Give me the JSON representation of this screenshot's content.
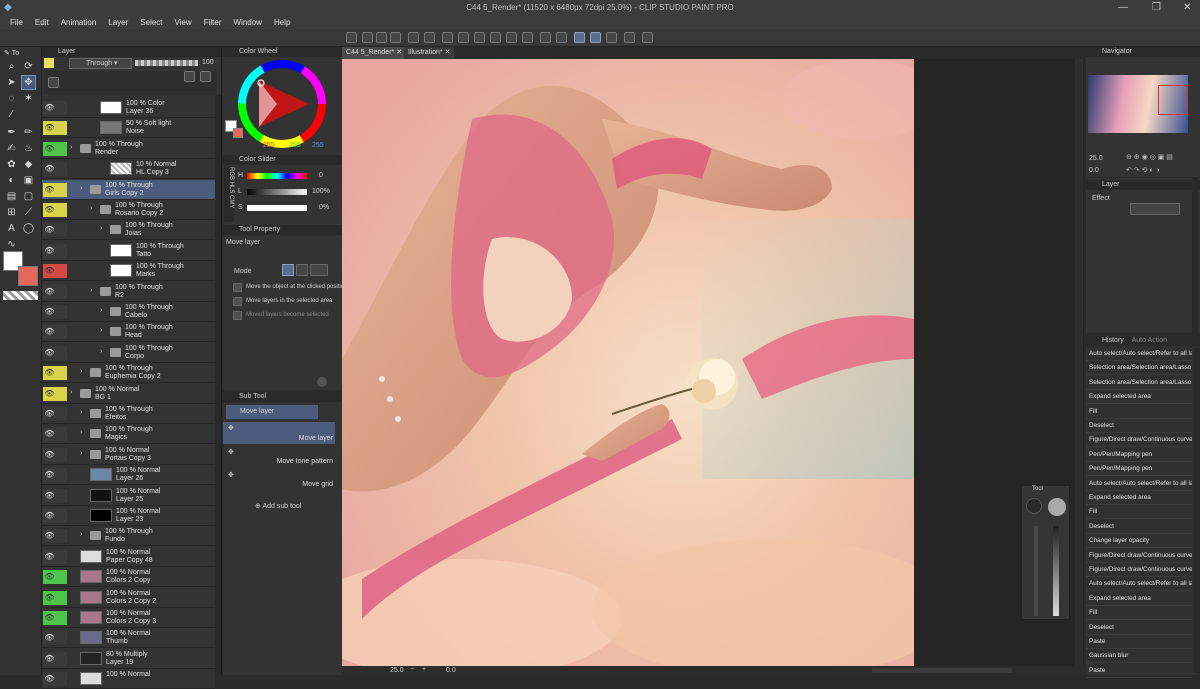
{
  "window": {
    "title": "C44 5_Render* (11520 x 6480px 72dpi 25.0%)  -  CLIP STUDIO PAINT PRO",
    "controls": [
      "—",
      "❐",
      "✕"
    ]
  },
  "menu": [
    "File",
    "Edit",
    "Animation",
    "Layer",
    "Select",
    "View",
    "Filter",
    "Window",
    "Help"
  ],
  "layer_panel": {
    "title": "Layer",
    "tool_tab": "To",
    "blend_mode": "Through",
    "opacity": "100",
    "layers": [
      {
        "pct": "100 % Color",
        "name": "Layer 36"
      },
      {
        "pct": "50 % Soft light",
        "name": "Noise"
      },
      {
        "pct": "100 % Through",
        "name": "Render"
      },
      {
        "pct": "10 % Normal",
        "name": "HL Copy 3"
      },
      {
        "pct": "100 % Through",
        "name": "Girls Copy 2"
      },
      {
        "pct": "100 % Through",
        "name": "Rosario Copy 2"
      },
      {
        "pct": "100 % Through",
        "name": "Joias"
      },
      {
        "pct": "100 % Through",
        "name": "Tatto"
      },
      {
        "pct": "100 % Through",
        "name": "Marks"
      },
      {
        "pct": "100 % Through",
        "name": "R2"
      },
      {
        "pct": "100 % Through",
        "name": "Cabelo"
      },
      {
        "pct": "100 % Through",
        "name": "Head"
      },
      {
        "pct": "100 % Through",
        "name": "Corpo"
      },
      {
        "pct": "100 % Through",
        "name": "Euphemia Copy 2"
      },
      {
        "pct": "100 % Normal",
        "name": "BG 1"
      },
      {
        "pct": "100 % Through",
        "name": "Efeitos"
      },
      {
        "pct": "100 % Through",
        "name": "Magics"
      },
      {
        "pct": "100 % Normal",
        "name": "Portais Copy 3"
      },
      {
        "pct": "100 % Normal",
        "name": "Layer 26"
      },
      {
        "pct": "100 % Normal",
        "name": "Layer 25"
      },
      {
        "pct": "100 % Normal",
        "name": "Layer 23"
      },
      {
        "pct": "100 % Through",
        "name": "Fundo"
      },
      {
        "pct": "100 % Normal",
        "name": "Paper Copy 48"
      },
      {
        "pct": "100 % Normal",
        "name": "Colors 2 Copy"
      },
      {
        "pct": "100 % Normal",
        "name": "Colors 2 Copy 2"
      },
      {
        "pct": "100 % Normal",
        "name": "Colors 2 Copy 3"
      },
      {
        "pct": "100 % Normal",
        "name": "Thumb"
      },
      {
        "pct": "80 % Multiply",
        "name": "Layer 19"
      },
      {
        "pct": "100 % Normal",
        "name": ""
      }
    ]
  },
  "color_wheel": {
    "title": "Color Wheel",
    "rgb": [
      "255",
      "255",
      "255"
    ]
  },
  "color_slider": {
    "title": "Color Slider",
    "tabs": [
      "RGB",
      "HLS",
      "CMY"
    ],
    "rows": [
      {
        "label": "H",
        "value": "0"
      },
      {
        "label": "L",
        "value": "100%"
      },
      {
        "label": "S",
        "value": "0%"
      }
    ]
  },
  "tool_property": {
    "title": "Tool Property",
    "tool": "Move layer",
    "mode_label": "Mode",
    "options": [
      "Move the object at the clicked position",
      "Move layers in the selected area",
      "Moved layers become selected"
    ]
  },
  "sub_tool": {
    "title": "Sub Tool",
    "group": "Move layer",
    "items": [
      "Move layer",
      "Move tone pattern",
      "Move grid"
    ],
    "add_label": "Add sub tool"
  },
  "canvas": {
    "tabs": [
      "C44 5_Render*",
      "Illustration*"
    ],
    "zoom": "25.0",
    "angle": "0.0"
  },
  "navigator": {
    "title": "Navigator",
    "zoom": "25.0",
    "angle": "0.0"
  },
  "layer_property": {
    "tab": "Layer",
    "effect_label": "Effect"
  },
  "history": {
    "title": "History",
    "tab2": "Auto Action",
    "items": [
      "Auto select/Auto select/Refer to all layers",
      "Selection area/Selection area/Lasso",
      "Selection area/Selection area/Lasso",
      "Expand selected area",
      "Fill",
      "Deselect",
      "Figure/Direct draw/Continuous curve",
      "Pen/Pen/Mapping pen",
      "Pen/Pen/Mapping pen",
      "Auto select/Auto select/Refer to all layers",
      "Expand selected area",
      "Fill",
      "Deselect",
      "Change layer opacity",
      "Figure/Direct draw/Continuous curve",
      "Figure/Direct draw/Continuous curve",
      "Auto select/Auto select/Refer to all layers",
      "Expand selected area",
      "Fill",
      "Deselect",
      "Paste",
      "Gaussian blur",
      "Paste"
    ]
  },
  "float_panel": {
    "title": "Tool"
  },
  "colors": {
    "accent": "#4b5c7c",
    "eye_yellow": "#d8d44a",
    "eye_green": "#4fc44a",
    "eye_red": "#d34a45",
    "main_color": "#ffffff",
    "sub_color": "#e8665a"
  }
}
